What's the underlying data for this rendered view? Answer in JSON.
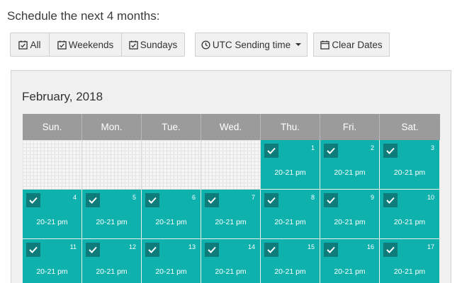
{
  "heading": "Schedule the next 4 months:",
  "toolbar": {
    "all_label": "All",
    "weekends_label": "Weekends",
    "sundays_label": "Sundays",
    "sending_time_label": "UTC Sending time",
    "clear_dates_label": "Clear Dates"
  },
  "icons": {
    "checkbox": "calendar-check-icon",
    "clock": "clock-icon",
    "calendar": "calendar-icon",
    "caret": "caret-down-icon",
    "check": "check-icon"
  },
  "colors": {
    "selected_day": "#0fb1ad",
    "check_box": "#0d7c7a",
    "header_bg": "#9b9b9b"
  },
  "calendar": {
    "month_title": "February, 2018",
    "weekdays": [
      "Sun.",
      "Mon.",
      "Tue.",
      "Wed.",
      "Thu.",
      "Fri.",
      "Sat."
    ],
    "weeks": [
      [
        null,
        null,
        null,
        null,
        {
          "day": "1",
          "time": "20-21 pm",
          "selected": true
        },
        {
          "day": "2",
          "time": "20-21 pm",
          "selected": true
        },
        {
          "day": "3",
          "time": "20-21 pm",
          "selected": true
        }
      ],
      [
        {
          "day": "4",
          "time": "20-21 pm",
          "selected": true
        },
        {
          "day": "5",
          "time": "20-21 pm",
          "selected": true
        },
        {
          "day": "6",
          "time": "20-21 pm",
          "selected": true
        },
        {
          "day": "7",
          "time": "20-21 pm",
          "selected": true
        },
        {
          "day": "8",
          "time": "20-21 pm",
          "selected": true
        },
        {
          "day": "9",
          "time": "20-21 pm",
          "selected": true
        },
        {
          "day": "10",
          "time": "20-21 pm",
          "selected": true
        }
      ],
      [
        {
          "day": "11",
          "time": "20-21 pm",
          "selected": true
        },
        {
          "day": "12",
          "time": "20-21 pm",
          "selected": true
        },
        {
          "day": "13",
          "time": "20-21 pm",
          "selected": true
        },
        {
          "day": "14",
          "time": "20-21 pm",
          "selected": true
        },
        {
          "day": "15",
          "time": "20-21 pm",
          "selected": true
        },
        {
          "day": "16",
          "time": "20-21 pm",
          "selected": true
        },
        {
          "day": "17",
          "time": "20-21 pm",
          "selected": true
        }
      ]
    ]
  }
}
